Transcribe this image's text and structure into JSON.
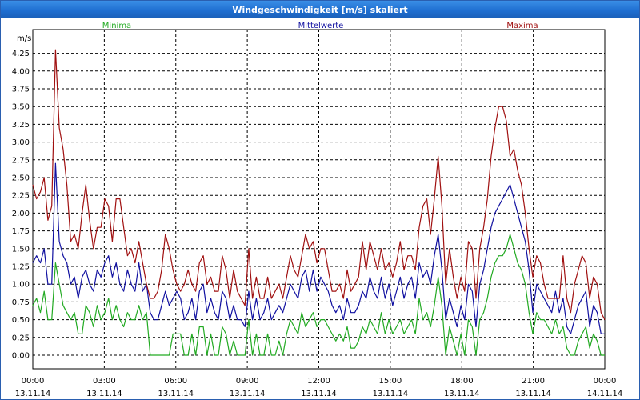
{
  "window": {
    "title": "Windgeschwindigkeit [m/s] skaliert"
  },
  "colors": {
    "minima": "#22aa22",
    "mittel": "#1010a0",
    "maxima": "#a01010",
    "grid": "#000000"
  },
  "chart_data": {
    "type": "line",
    "title": "Windgeschwindigkeit [m/s] skaliert",
    "ylabel": "m/s",
    "xlabel": "",
    "ylim": [
      0,
      4.5
    ],
    "yticks": [
      "0,00",
      "0,25",
      "0,50",
      "0,75",
      "1,00",
      "1,25",
      "1,50",
      "1,75",
      "2,00",
      "2,25",
      "2,50",
      "2,75",
      "3,00",
      "3,25",
      "3,50",
      "3,75",
      "4,00",
      "4,25"
    ],
    "xticks": [
      {
        "time": "00:00",
        "date": "13.11.14"
      },
      {
        "time": "03:00",
        "date": "13.11.14"
      },
      {
        "time": "06:00",
        "date": "13.11.14"
      },
      {
        "time": "09:00",
        "date": "13.11.14"
      },
      {
        "time": "12:00",
        "date": "13.11.14"
      },
      {
        "time": "15:00",
        "date": "13.11.14"
      },
      {
        "time": "18:00",
        "date": "13.11.14"
      },
      {
        "time": "21:00",
        "date": "13.11.14"
      },
      {
        "time": "00:00",
        "date": "14.11.14"
      }
    ],
    "grid": true,
    "series": [
      {
        "name": "Minima",
        "values": [
          0.7,
          0.8,
          0.6,
          0.9,
          0.5,
          0.5,
          1.3,
          1.0,
          0.7,
          0.6,
          0.5,
          0.6,
          0.3,
          0.3,
          0.7,
          0.6,
          0.4,
          0.7,
          0.5,
          0.6,
          0.8,
          0.5,
          0.7,
          0.5,
          0.4,
          0.6,
          0.5,
          0.5,
          0.7,
          0.5,
          0.6,
          0.0,
          0.0,
          0.0,
          0.0,
          0.0,
          0.0,
          0.3,
          0.3,
          0.3,
          0.0,
          0.0,
          0.3,
          0.0,
          0.4,
          0.4,
          0.0,
          0.3,
          0.0,
          0.0,
          0.4,
          0.3,
          0.0,
          0.2,
          0.0,
          0.0,
          0.0,
          0.5,
          0.0,
          0.3,
          0.0,
          0.0,
          0.3,
          0.0,
          0.0,
          0.2,
          0.0,
          0.3,
          0.5,
          0.4,
          0.3,
          0.6,
          0.4,
          0.5,
          0.6,
          0.4,
          0.5,
          0.5,
          0.4,
          0.3,
          0.2,
          0.3,
          0.2,
          0.4,
          0.1,
          0.1,
          0.2,
          0.4,
          0.3,
          0.5,
          0.4,
          0.3,
          0.6,
          0.3,
          0.5,
          0.3,
          0.4,
          0.5,
          0.3,
          0.4,
          0.5,
          0.3,
          0.8,
          0.5,
          0.6,
          0.4,
          0.7,
          1.1,
          0.7,
          0.0,
          0.4,
          0.2,
          0.0,
          0.3,
          0.0,
          0.5,
          0.4,
          0.0,
          0.5,
          0.6,
          0.8,
          1.1,
          1.3,
          1.4,
          1.4,
          1.5,
          1.7,
          1.5,
          1.3,
          1.2,
          1.0,
          0.6,
          0.3,
          0.6,
          0.5,
          0.5,
          0.4,
          0.3,
          0.5,
          0.3,
          0.4,
          0.1,
          0.0,
          0.0,
          0.2,
          0.3,
          0.4,
          0.1,
          0.3,
          0.2,
          0.0,
          0.0
        ],
        "color": "#22aa22"
      },
      {
        "name": "Mittelwerte",
        "values": [
          1.3,
          1.4,
          1.3,
          1.5,
          1.0,
          1.0,
          2.7,
          1.6,
          1.4,
          1.3,
          1.0,
          1.1,
          0.8,
          1.1,
          1.2,
          1.0,
          0.9,
          1.2,
          1.1,
          1.3,
          1.4,
          1.1,
          1.3,
          1.0,
          0.9,
          1.2,
          1.0,
          0.9,
          1.3,
          0.9,
          1.0,
          0.6,
          0.5,
          0.5,
          0.7,
          0.9,
          0.7,
          0.8,
          0.9,
          0.8,
          0.5,
          0.6,
          0.8,
          0.5,
          0.9,
          1.0,
          0.6,
          0.8,
          0.6,
          0.5,
          0.9,
          0.8,
          0.5,
          0.7,
          0.5,
          0.5,
          0.4,
          0.9,
          0.5,
          0.8,
          0.5,
          0.6,
          0.8,
          0.5,
          0.6,
          0.7,
          0.6,
          0.8,
          1.0,
          0.9,
          0.8,
          1.1,
          1.2,
          0.9,
          1.2,
          0.9,
          1.1,
          1.0,
          0.9,
          0.7,
          0.6,
          0.7,
          0.5,
          0.8,
          0.6,
          0.6,
          0.7,
          0.9,
          0.8,
          1.1,
          0.9,
          0.8,
          1.1,
          0.8,
          1.0,
          0.7,
          0.9,
          1.1,
          0.8,
          1.0,
          1.1,
          0.8,
          1.3,
          1.1,
          1.2,
          1.0,
          1.4,
          1.7,
          1.2,
          0.5,
          0.8,
          0.6,
          0.4,
          0.7,
          0.5,
          1.0,
          0.9,
          0.4,
          1.0,
          1.2,
          1.5,
          1.8,
          2.0,
          2.1,
          2.2,
          2.3,
          2.4,
          2.2,
          2.0,
          1.8,
          1.6,
          1.2,
          0.6,
          1.0,
          0.9,
          0.8,
          0.7,
          0.6,
          0.9,
          0.6,
          0.8,
          0.4,
          0.3,
          0.5,
          0.7,
          0.8,
          0.9,
          0.4,
          0.7,
          0.6,
          0.3,
          0.3
        ],
        "color": "#1010a0"
      },
      {
        "name": "Maxima",
        "values": [
          2.4,
          2.2,
          2.3,
          2.5,
          1.9,
          2.1,
          4.3,
          3.2,
          2.9,
          2.4,
          1.6,
          1.7,
          1.5,
          2.0,
          2.4,
          1.9,
          1.5,
          1.8,
          1.8,
          2.2,
          2.1,
          1.6,
          2.2,
          2.2,
          1.8,
          1.4,
          1.5,
          1.3,
          1.6,
          1.3,
          1.0,
          0.8,
          0.8,
          0.9,
          1.2,
          1.7,
          1.5,
          1.2,
          1.0,
          0.9,
          1.0,
          1.2,
          1.0,
          0.9,
          1.3,
          1.4,
          1.0,
          1.1,
          0.9,
          0.9,
          1.4,
          1.2,
          0.8,
          1.2,
          0.9,
          0.8,
          0.7,
          1.5,
          0.8,
          1.1,
          0.8,
          0.8,
          1.1,
          0.8,
          0.9,
          1.0,
          0.8,
          1.1,
          1.4,
          1.2,
          1.1,
          1.4,
          1.7,
          1.5,
          1.6,
          1.3,
          1.5,
          1.5,
          1.2,
          0.9,
          0.9,
          1.0,
          0.8,
          1.2,
          0.9,
          1.0,
          1.1,
          1.6,
          1.2,
          1.6,
          1.4,
          1.2,
          1.5,
          1.2,
          1.3,
          1.1,
          1.3,
          1.6,
          1.2,
          1.4,
          1.4,
          1.2,
          1.8,
          2.1,
          2.2,
          1.7,
          2.2,
          2.8,
          2.1,
          1.0,
          1.5,
          1.1,
          0.8,
          1.1,
          0.9,
          1.6,
          1.5,
          0.8,
          1.5,
          1.8,
          2.2,
          2.8,
          3.2,
          3.5,
          3.5,
          3.3,
          2.8,
          2.9,
          2.6,
          2.4,
          2.0,
          1.5,
          1.1,
          1.4,
          1.3,
          1.0,
          0.8,
          0.8,
          0.8,
          0.8,
          1.4,
          0.8,
          0.6,
          1.0,
          1.2,
          1.4,
          1.3,
          0.8,
          1.1,
          1.0,
          0.6,
          0.5
        ],
        "color": "#a01010"
      }
    ]
  }
}
